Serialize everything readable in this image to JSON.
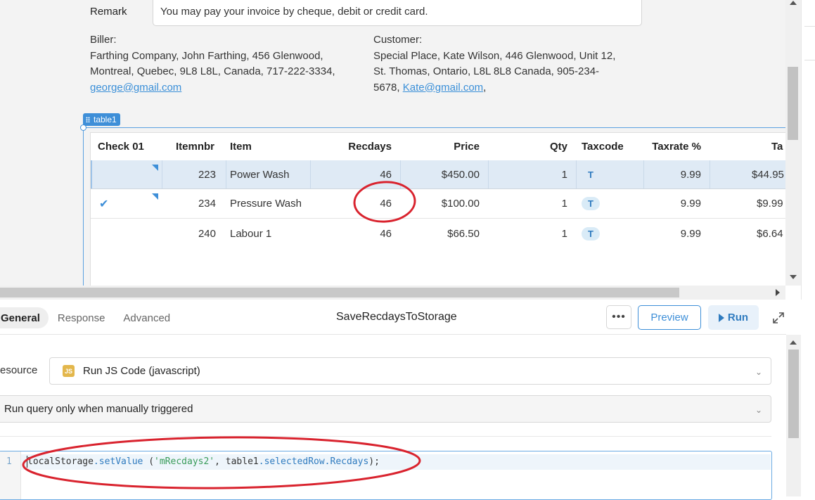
{
  "invoice": {
    "remark_label": "Remark",
    "remark_value": "You may pay your invoice by cheque, debit or credit card.",
    "biller": {
      "label": "Biller:",
      "line1": "Farthing Company, John Farthing, 456 Glenwood,",
      "line2": "Montreal, Quebec, 9L8 L8L, Canada, 717-222-3334,",
      "email": "george@gmail.com"
    },
    "customer": {
      "label": "Customer:",
      "line1": "Special Place, Kate Wilson, 446 Glenwood, Unit 12,",
      "line2": "St. Thomas, Ontario, L8L 8L8 Canada, 905-234-",
      "line3_prefix": "5678, ",
      "email": "Kate@gmail.com",
      "line3_suffix": ","
    }
  },
  "table": {
    "component_name": "table1",
    "columns": [
      "Check 01",
      "Itemnbr",
      "Item",
      "Recdays",
      "Price",
      "Qty",
      "Taxcode",
      "Taxrate %",
      "Ta"
    ],
    "rows": [
      {
        "check": "",
        "itemnbr": "223",
        "item": "Power Wash",
        "recdays": "46",
        "price": "$450.00",
        "qty": "1",
        "taxcode": "T",
        "taxrate": "9.99",
        "tax": "$44.95",
        "selected": true
      },
      {
        "check": "✔",
        "itemnbr": "234",
        "item": "Pressure Wash",
        "recdays": "46",
        "price": "$100.00",
        "qty": "1",
        "taxcode": "T",
        "taxrate": "9.99",
        "tax": "$9.99",
        "selected": false
      },
      {
        "check": "",
        "itemnbr": "240",
        "item": "Labour 1",
        "recdays": "46",
        "price": "$66.50",
        "qty": "1",
        "taxcode": "T",
        "taxrate": "9.99",
        "tax": "$6.64",
        "selected": false
      }
    ]
  },
  "query": {
    "tabs": [
      "General",
      "Response",
      "Advanced"
    ],
    "active_tab": "General",
    "name": "SaveRecdaysToStorage",
    "more_label": "•••",
    "preview_label": "Preview",
    "run_label": "Run",
    "resource_label": "esource",
    "resource_badge": "JS",
    "resource_value": "Run JS Code (javascript)",
    "trigger_value": "Run query only when manually triggered",
    "code_line_number": "1",
    "code": {
      "obj": "localStorage",
      "dot1": ".",
      "method": "setValue",
      "open": " (",
      "str": "'mRecdays2'",
      "mid": ", table1",
      "dot2": ".",
      "prop1": "selectedRow",
      "dot3": ".",
      "prop2": "Recdays",
      "close": ");"
    }
  },
  "colors": {
    "accent": "#3e8fd8",
    "annotation": "#d9232e",
    "selected_row": "#dfeaf5",
    "js_badge": "#e3b74c"
  },
  "icons": [
    "drag-grip-icon",
    "checkmark-icon",
    "ellipsis-icon",
    "play-icon",
    "expand-icon",
    "chevron-down-icon",
    "js-badge-icon"
  ]
}
